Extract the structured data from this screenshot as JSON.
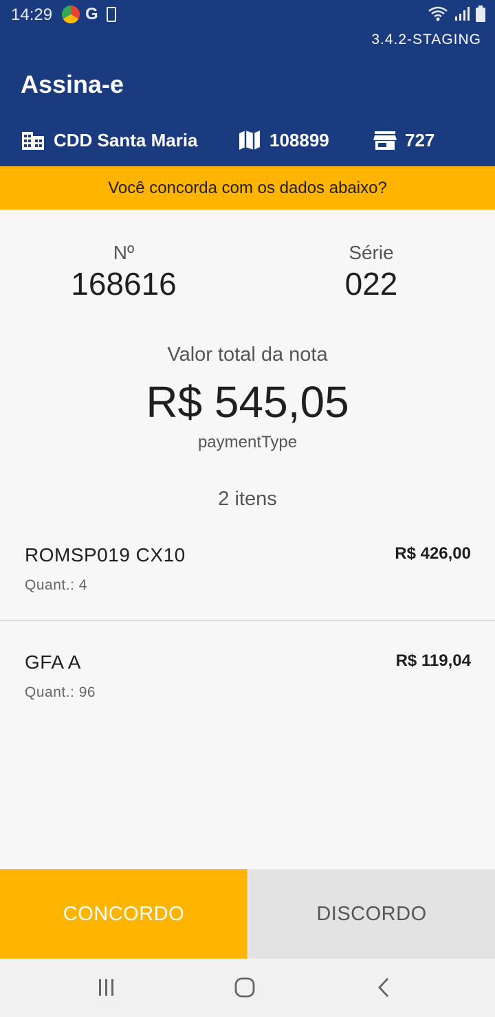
{
  "status_bar": {
    "time": "14:29",
    "apps": [
      "chrome-icon",
      "google-icon",
      "battery-saver-icon"
    ],
    "right_icons": [
      "wifi-icon",
      "signal-icon",
      "battery-icon"
    ]
  },
  "header": {
    "version": "3.4.2-STAGING",
    "title": "Assina-e",
    "info": [
      {
        "icon": "building-icon",
        "text": "CDD Santa Maria"
      },
      {
        "icon": "map-icon",
        "text": "108899"
      },
      {
        "icon": "store-icon",
        "text": "727"
      }
    ],
    "color": "#1a3b80"
  },
  "banner": {
    "text": "Você concorda com os dados abaixo?",
    "color": "#ffb400"
  },
  "invoice": {
    "number_label": "Nº",
    "number": "168616",
    "series_label": "Série",
    "series": "022",
    "total_label": "Valor total da nota",
    "total": "R$ 545,05",
    "payment_type": "paymentType",
    "items_count": "2 itens"
  },
  "items": [
    {
      "name": "ROMSP019 CX10",
      "quantity": "Quant.: 4",
      "price": "R$ 426,00"
    },
    {
      "name": "GFA A",
      "quantity": "Quant.: 96",
      "price": "R$ 119,04"
    }
  ],
  "actions": {
    "agree": "CONCORDO",
    "disagree": "DISCORDO"
  },
  "nav_bar": [
    "recent-apps-icon",
    "home-icon",
    "back-icon"
  ]
}
